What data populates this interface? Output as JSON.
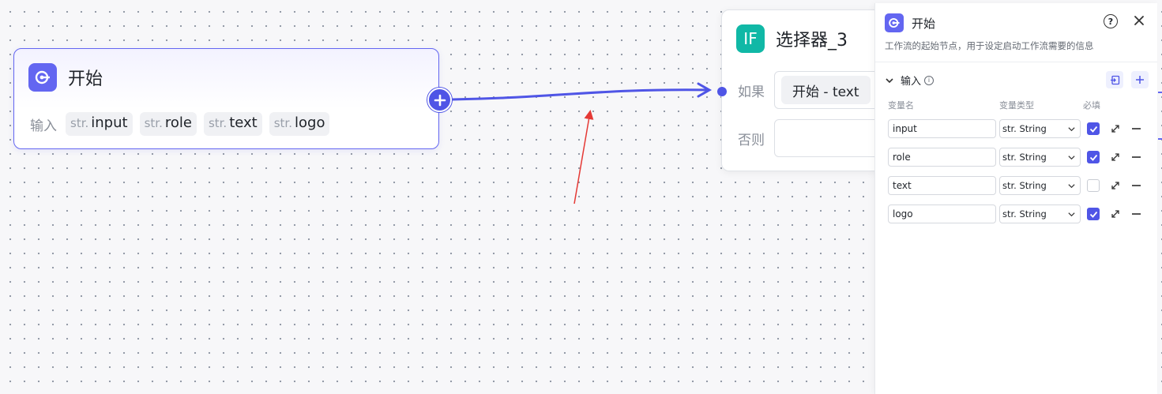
{
  "start_node": {
    "title": "开始",
    "input_label": "输入",
    "inputs": [
      {
        "type": "str.",
        "name": "input"
      },
      {
        "type": "str.",
        "name": "role"
      },
      {
        "type": "str.",
        "name": "text"
      },
      {
        "type": "str.",
        "name": "logo"
      }
    ]
  },
  "selector_node": {
    "icon_text": "IF",
    "title": "选择器_3",
    "if_label": "如果",
    "if_value": "开始  -  text",
    "else_label": "否则"
  },
  "panel": {
    "title": "开始",
    "description": "工作流的起始节点，用于设定启动工作流需要的信息",
    "help_icon": "?",
    "section_title": "输入",
    "columns": {
      "name": "变量名",
      "type": "变量类型",
      "required": "必填"
    },
    "variables": [
      {
        "name": "input",
        "type": "str. String",
        "required": true
      },
      {
        "name": "role",
        "type": "str. String",
        "required": true
      },
      {
        "name": "text",
        "type": "str. String",
        "required": false
      },
      {
        "name": "logo",
        "type": "str. String",
        "required": true
      }
    ]
  },
  "colors": {
    "accent": "#6366f1",
    "if_icon": "#10b8a6",
    "annotation_arrow": "#e53935"
  },
  "icons": [
    "start-node-icon",
    "plus-icon",
    "if-icon",
    "help-icon",
    "close-icon",
    "chevron-down-icon",
    "info-icon",
    "import-icon",
    "add-icon",
    "expand-icon",
    "remove-icon",
    "caret-down-icon",
    "check-icon"
  ]
}
